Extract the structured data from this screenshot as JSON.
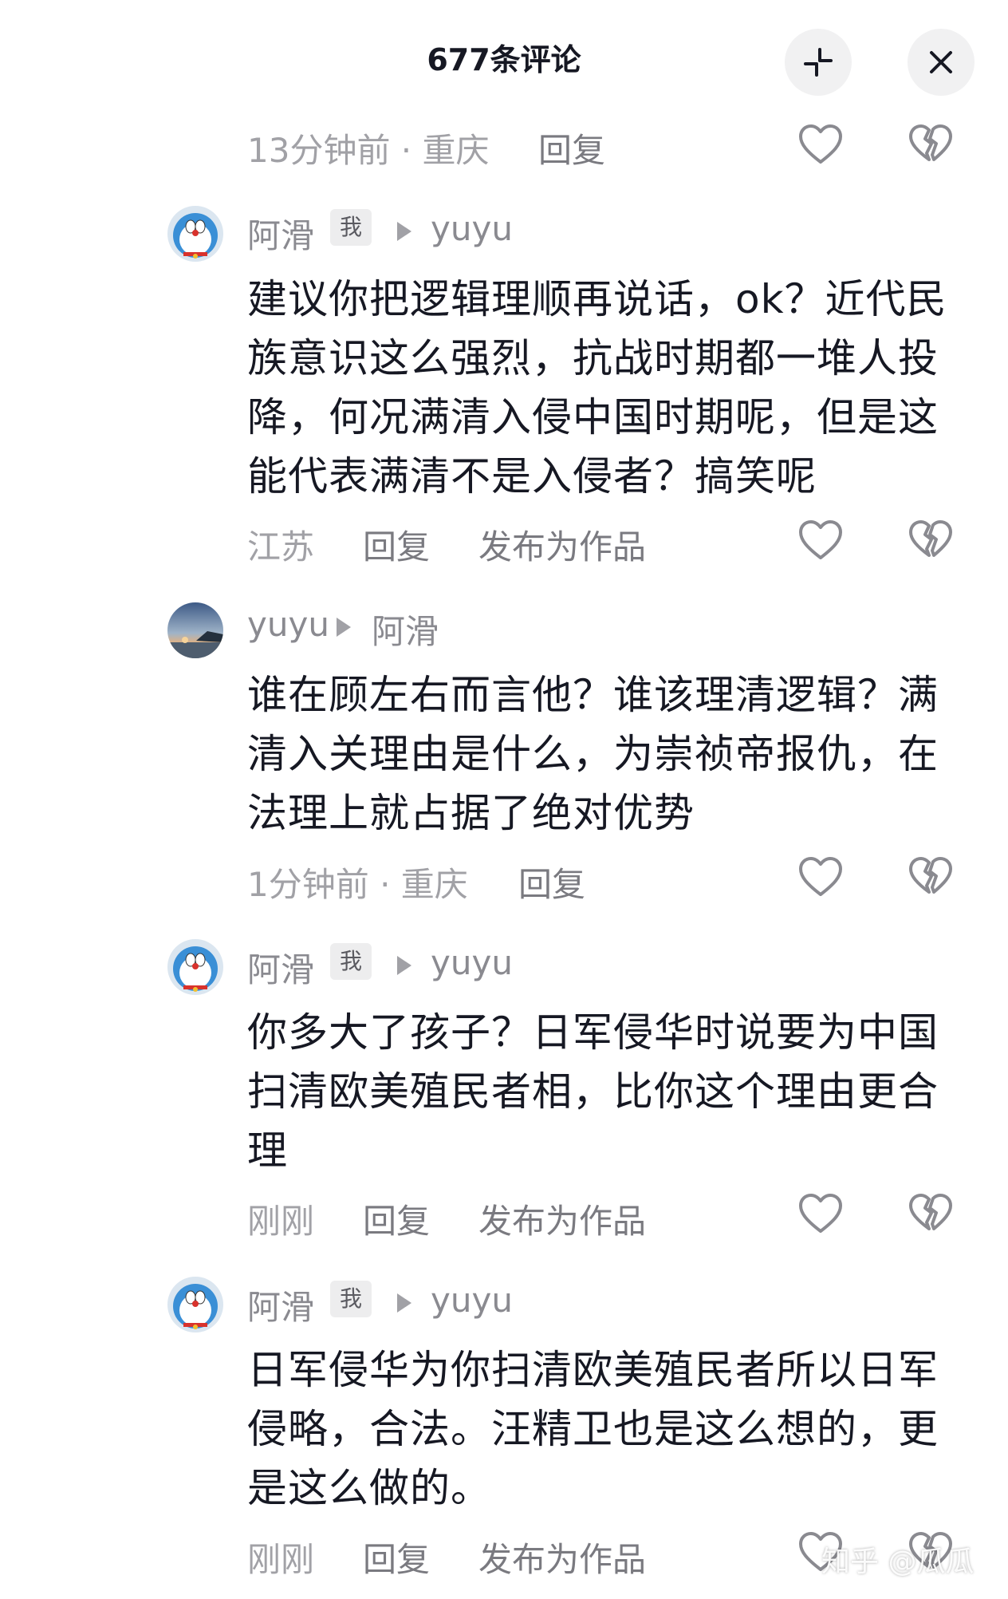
{
  "header": {
    "title": "677条评论"
  },
  "top_meta": {
    "time": "13分钟前 · 重庆",
    "reply": "回复"
  },
  "comments": [
    {
      "user": "阿滑",
      "badge": "我",
      "reply_to": "yuyu",
      "text": "建议你把逻辑理顺再说话，ok？近代民族意识这么强烈，抗战时期都一堆人投降，何况满清入侵中国时期呢，但是这能代表满清不是入侵者？搞笑呢",
      "lines": [
        "建议你把逻辑理顺再说话，ok？近代民",
        "族意识这么强烈，抗战时期都一堆人投",
        "降，何况满清入侵中国时期呢，但是这",
        "能代表满清不是入侵者？搞笑呢"
      ],
      "location": "江苏",
      "reply": "回复",
      "publish": "发布为作品"
    },
    {
      "user": "yuyu",
      "reply_to": "阿滑",
      "lines": [
        "谁在顾左右而言他？谁该理清逻辑？满",
        "清入关理由是什么，为崇祯帝报仇，在",
        "法理上就占据了绝对优势"
      ],
      "time": "1分钟前 · 重庆",
      "reply": "回复"
    },
    {
      "user": "阿滑",
      "badge": "我",
      "reply_to": "yuyu",
      "lines": [
        "你多大了孩子？日军侵华时说要为中国",
        "扫清欧美殖民者相，比你这个理由更合",
        "理"
      ],
      "location": "刚刚",
      "reply": "回复",
      "publish": "发布为作品"
    },
    {
      "user": "阿滑",
      "badge": "我",
      "reply_to": "yuyu",
      "lines": [
        "日军侵华为你扫清欧美殖民者所以日军",
        "侵略，合法。汪精卫也是这么想的，更",
        "是这么做的。"
      ],
      "location": "刚刚",
      "reply": "回复",
      "publish": "发布为作品"
    }
  ],
  "watermark": "知乎 @瓜瓜",
  "icons": {
    "collapse": "collapse-icon",
    "close": "close-icon",
    "like": "heart-icon",
    "dislike": "broken-heart-icon"
  }
}
